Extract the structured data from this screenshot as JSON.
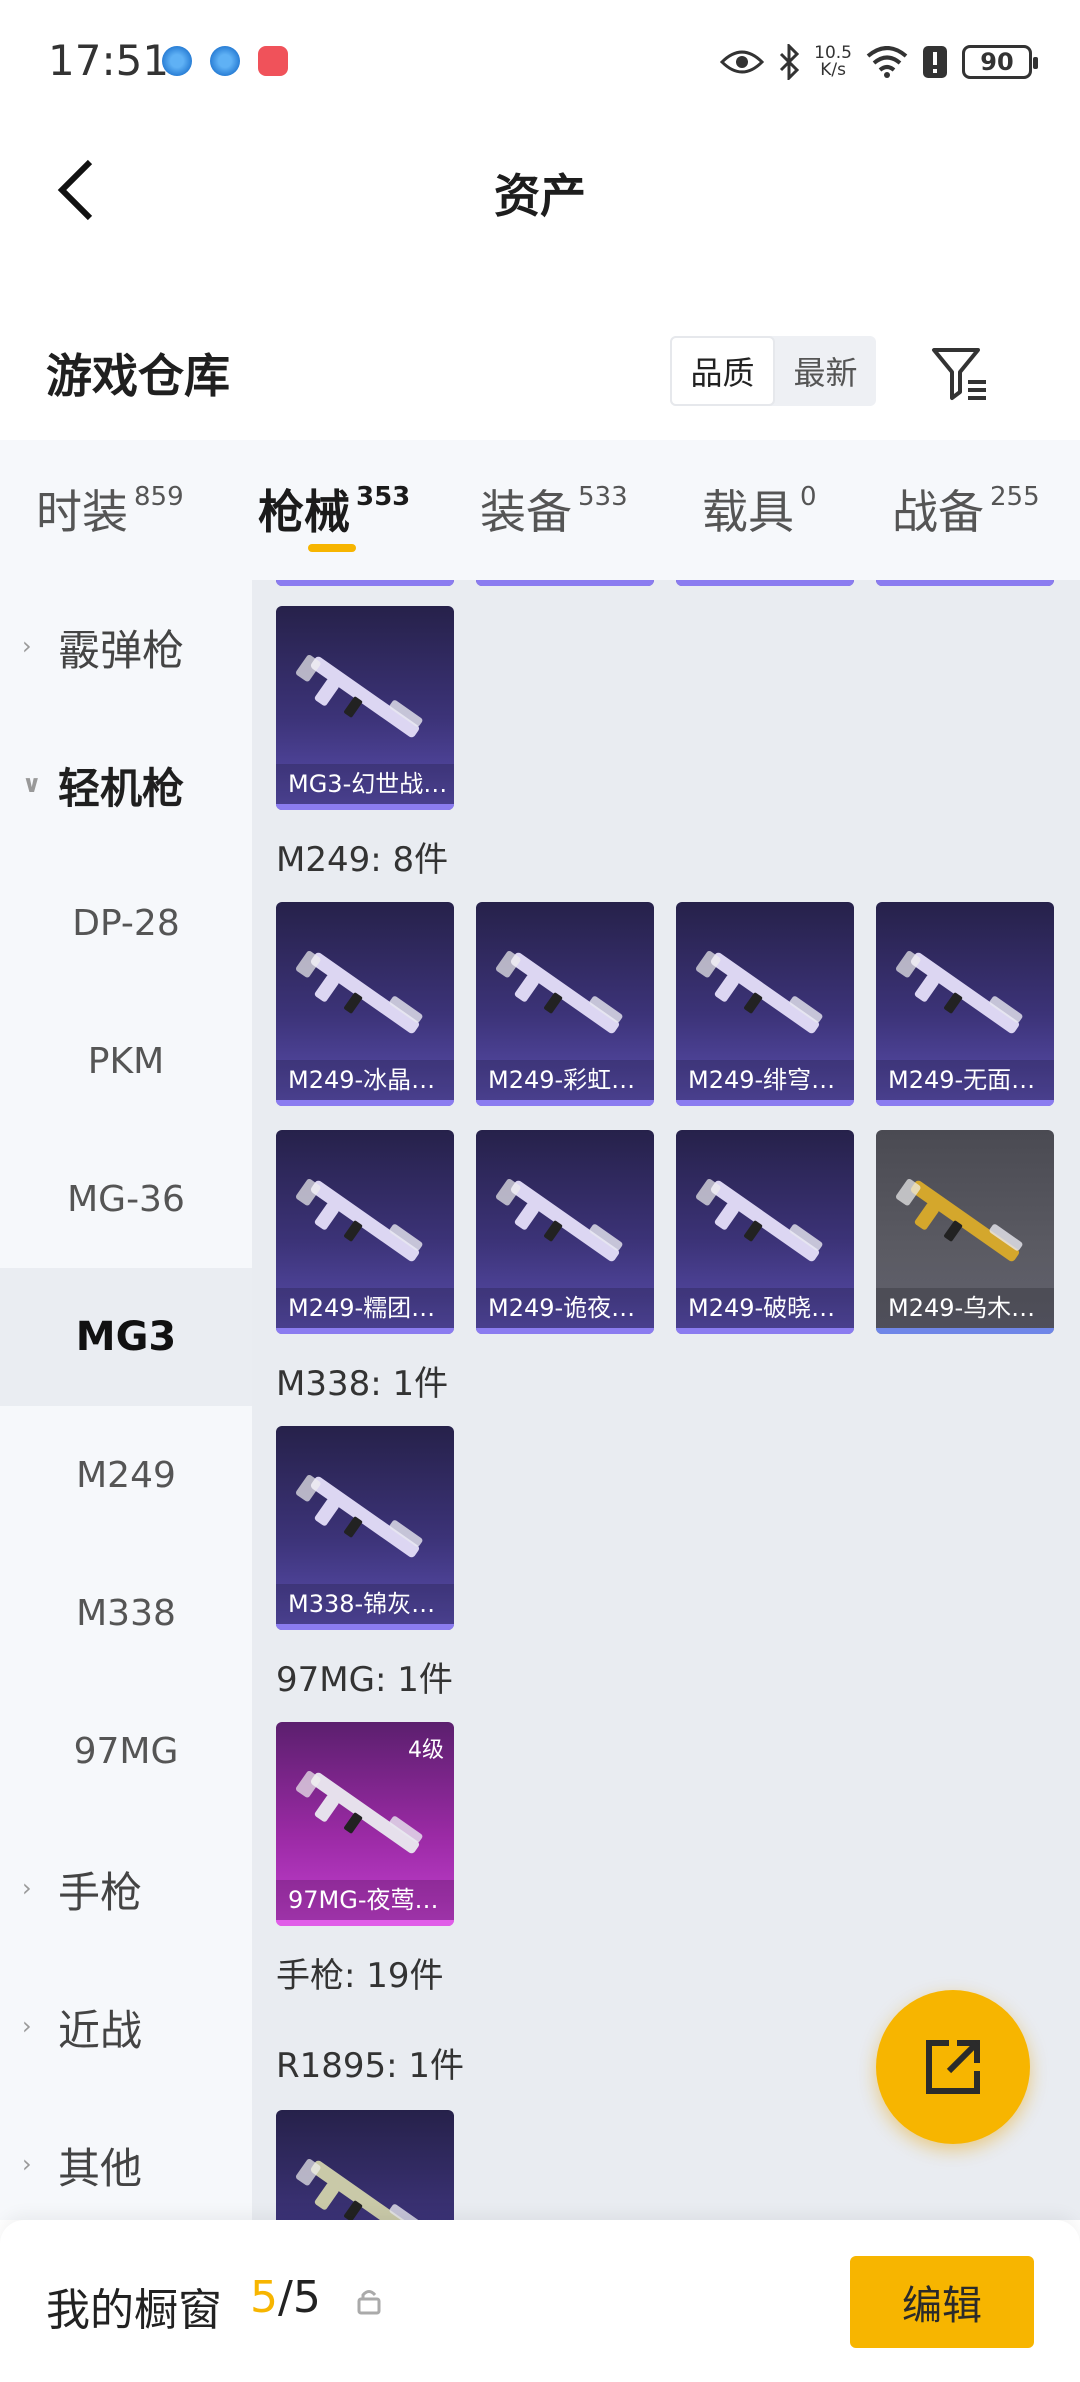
{
  "status_bar": {
    "time": "17:51",
    "net_speed_value": "10.5",
    "net_speed_unit": "K/s",
    "battery": "90",
    "icons": [
      "app-notification-icon",
      "app-notification-icon",
      "shopping-bag-icon",
      "eye-icon",
      "bluetooth-icon",
      "wifi-icon",
      "alert-icon",
      "battery-icon"
    ]
  },
  "header": {
    "title": "资产",
    "back_icon": "chevron-left-icon"
  },
  "warehouse": {
    "title": "游戏仓库",
    "sort_options": [
      "品质",
      "最新"
    ],
    "sort_selected": "品质",
    "filter_icon": "filter-icon"
  },
  "tabs": [
    {
      "label": "时装",
      "count": "859"
    },
    {
      "label": "枪械",
      "count": "353",
      "active": true
    },
    {
      "label": "装备",
      "count": "533"
    },
    {
      "label": "载具",
      "count": "0"
    },
    {
      "label": "战备",
      "count": "255"
    }
  ],
  "sidebar": {
    "items": [
      {
        "label": "霰弹枪",
        "type": "group"
      },
      {
        "label": "轻机枪",
        "type": "group",
        "expanded": true
      },
      {
        "label": "DP-28",
        "type": "sub"
      },
      {
        "label": "PKM",
        "type": "sub"
      },
      {
        "label": "MG-36",
        "type": "sub"
      },
      {
        "label": "MG3",
        "type": "sub",
        "active": true
      },
      {
        "label": "M249",
        "type": "sub"
      },
      {
        "label": "M338",
        "type": "sub"
      },
      {
        "label": "97MG",
        "type": "sub"
      },
      {
        "label": "手枪",
        "type": "group"
      },
      {
        "label": "近战",
        "type": "group"
      },
      {
        "label": "其他",
        "type": "group"
      }
    ]
  },
  "sections": {
    "m249": "M249: 8件",
    "m338": "M338: 1件",
    "mg97": "97MG: 1件",
    "pistol": "手枪: 19件",
    "r1895": "R1895: 1件"
  },
  "cards": {
    "mg3": [
      {
        "name": "MG3-幻世战…",
        "quality": "purple"
      }
    ],
    "m249": [
      {
        "name": "M249-冰晶…",
        "quality": "purple"
      },
      {
        "name": "M249-彩虹…",
        "quality": "purple"
      },
      {
        "name": "M249-绯穹…",
        "quality": "purple"
      },
      {
        "name": "M249-无面…",
        "quality": "purple"
      },
      {
        "name": "M249-糯团…",
        "quality": "purple"
      },
      {
        "name": "M249-诡夜…",
        "quality": "purple"
      },
      {
        "name": "M249-破晓…",
        "quality": "purple"
      },
      {
        "name": "M249-乌木…",
        "quality": "grey"
      }
    ],
    "m338": [
      {
        "name": "M338-锦灰…",
        "quality": "purple"
      }
    ],
    "mg97": [
      {
        "name": "97MG-夜莺…",
        "quality": "pink",
        "level": "4级"
      }
    ]
  },
  "fab": {
    "icon": "share-external-icon"
  },
  "bottom_bar": {
    "title": "我的橱窗",
    "count_current": "5",
    "count_sep": "/",
    "count_total": "5",
    "lock_icon": "lock-icon",
    "edit_label": "编辑"
  },
  "colors": {
    "accent": "#f7b500",
    "purple_card": "#3c3378",
    "grey_card": "#5b5b63",
    "pink_card": "#9a2aa4"
  }
}
